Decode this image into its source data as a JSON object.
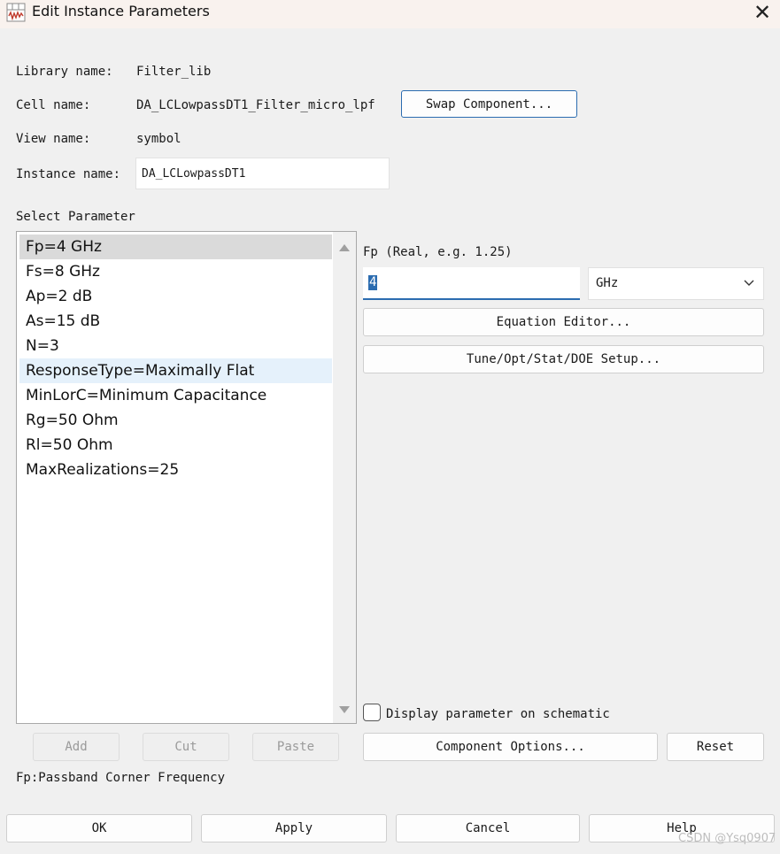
{
  "window": {
    "title": "Edit Instance Parameters",
    "app_icon": "waveform-app-icon",
    "close_icon": "close-icon"
  },
  "info": {
    "library_label": "Library name:",
    "library_value": "Filter_lib",
    "cell_label": "Cell name:",
    "cell_value": "DA_LCLowpassDT1_Filter_micro_lpf",
    "swap_button": "Swap Component...",
    "view_label": "View name:",
    "view_value": "symbol",
    "instance_label": "Instance name:",
    "instance_value": "DA_LCLowpassDT1"
  },
  "params": {
    "section_label": "Select Parameter",
    "items": [
      "Fp=4 GHz",
      "Fs=8 GHz",
      "Ap=2 dB",
      "As=15 dB",
      "N=3",
      "ResponseType=Maximally Flat",
      "MinLorC=Minimum Capacitance",
      "Rg=50 Ohm",
      "Rl=50 Ohm",
      "MaxRealizations=25"
    ],
    "selected_index": 0,
    "hover_index": 5
  },
  "editor": {
    "param_hint": "Fp (Real, e.g. 1.25)",
    "value": "4",
    "unit": "GHz",
    "equation_button": "Equation Editor...",
    "tune_button": "Tune/Opt/Stat/DOE Setup...",
    "display_checkbox_label": "Display parameter on schematic",
    "display_checked": false
  },
  "list_buttons": {
    "add": "Add",
    "cut": "Cut",
    "paste": "Paste"
  },
  "option_buttons": {
    "component_options": "Component Options...",
    "reset": "Reset"
  },
  "description": "Fp:Passband Corner Frequency",
  "footer": {
    "ok": "OK",
    "apply": "Apply",
    "cancel": "Cancel",
    "help": "Help"
  },
  "watermark": "CSDN @Ysq0907",
  "colors": {
    "selected_bg": "#dadada",
    "hover_bg": "#e5f1fb",
    "accent": "#2b6cb0"
  }
}
